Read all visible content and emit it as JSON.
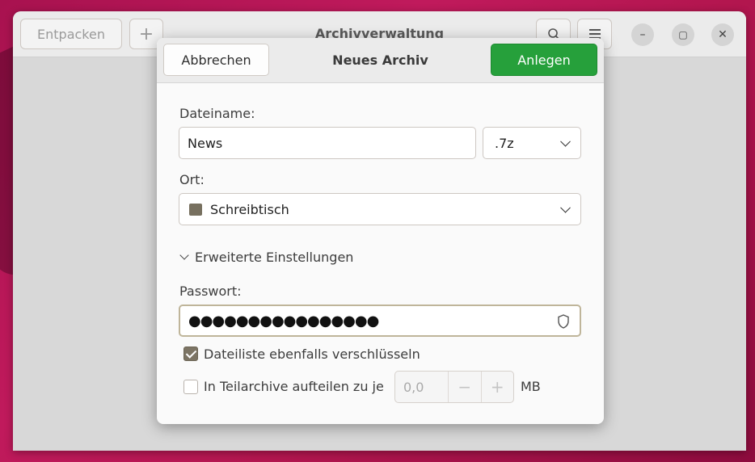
{
  "main_window": {
    "title": "Archivverwaltung",
    "extract_label": "Entpacken",
    "add_label": "+",
    "controls": {
      "minimize": "–",
      "maximize": "▢",
      "close": "✕"
    }
  },
  "dialog": {
    "title": "Neues Archiv",
    "cancel_label": "Abbrechen",
    "create_label": "Anlegen",
    "filename_label": "Dateiname:",
    "filename_value": "News",
    "extension_value": ".7z",
    "location_label": "Ort:",
    "location_value": "Schreibtisch",
    "advanced_label": "Erweiterte Einstellungen",
    "password_label": "Passwort:",
    "password_mask": "●●●●●●●●●●●●●●●●",
    "encrypt_list_label": "Dateiliste ebenfalls verschlüsseln",
    "encrypt_list_checked": true,
    "split_label": "In Teilarchive aufteilen zu je",
    "split_checked": false,
    "split_value": "0,0",
    "split_minus": "−",
    "split_plus": "+",
    "split_unit": "MB"
  },
  "colors": {
    "accent_green": "#26a03b",
    "checkbox_checked": "#7c7464"
  }
}
